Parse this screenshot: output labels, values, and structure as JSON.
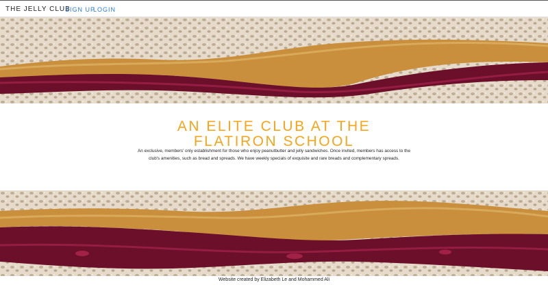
{
  "nav": {
    "brand": "THE JELLY CLUB",
    "signup_label": "SIGN UP",
    "login_label": "LOGIN"
  },
  "hero": {
    "headline": "AN ELITE CLUB AT THE FLATIRON SCHOOL",
    "description": "An exclusive, members' only establishment for those who enjoy peanutbutter and jelly sandwiches. Once invited, members has access to the club's amenities, such as bread and spreads. We have weekly specials of exquisite and rare breads and complementary spreads."
  },
  "footer": {
    "credit": "Website created by Elizabeth Le and Mohammed Ali"
  },
  "colors": {
    "accent": "#f6a51a",
    "link": "#2a7bd3",
    "jelly": "#6b0f2a",
    "peanut_butter": "#c98f3c",
    "bread": "#e4d8c7"
  }
}
